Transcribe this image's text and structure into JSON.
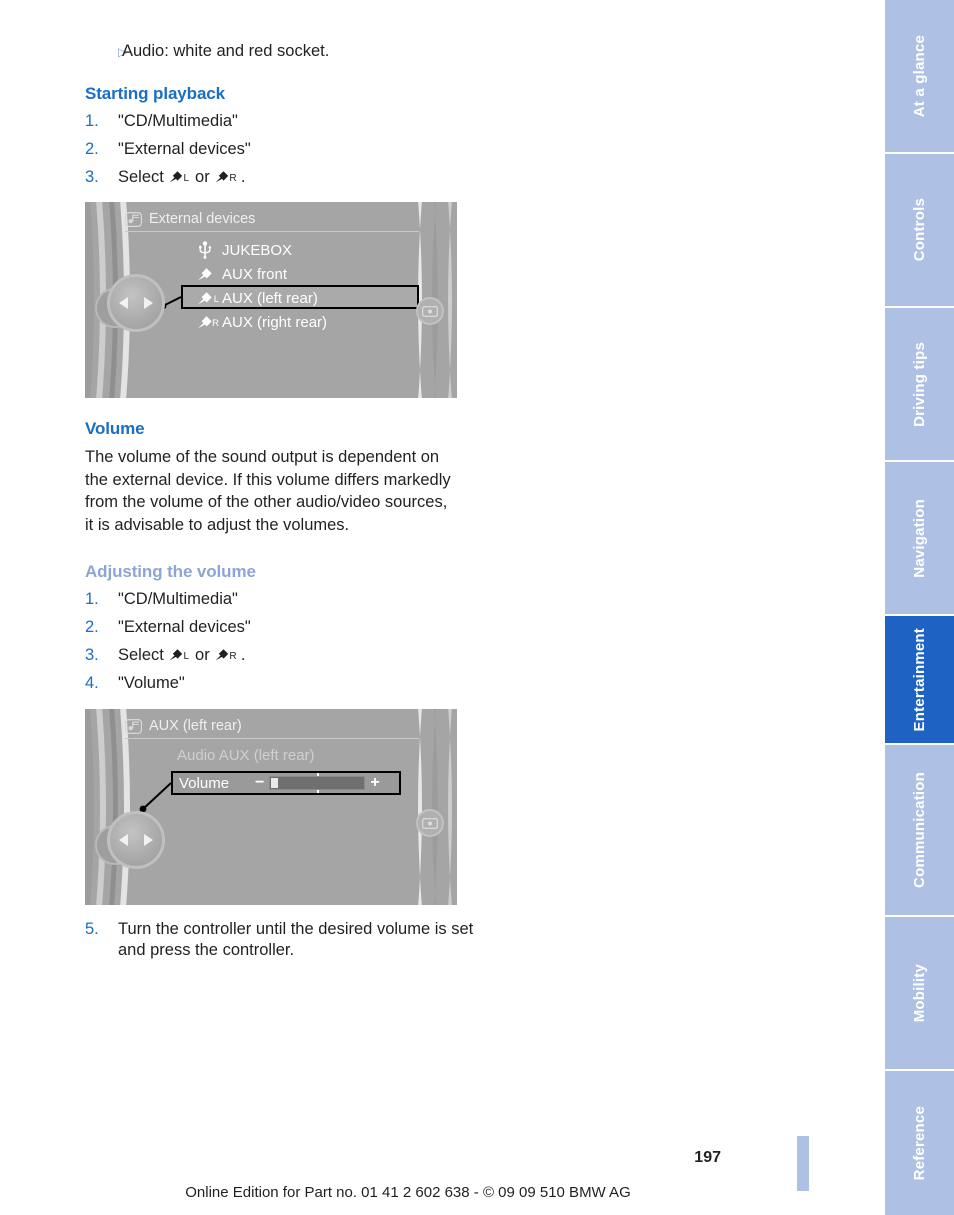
{
  "document": {
    "page_number": "197",
    "footer": "Online Edition for Part no. 01 41 2 602 638 - © 09 09 510 BMW AG"
  },
  "content": {
    "bullet": {
      "marker": "▷",
      "text": "Audio: white and red socket."
    },
    "starting_playback": {
      "heading": "Starting playback",
      "steps": [
        {
          "num": "1.",
          "text": "\"CD/Multimedia\""
        },
        {
          "num": "2.",
          "text": "\"External devices\""
        },
        {
          "num": "3.",
          "prefix": "Select",
          "icon_left": "L",
          "middle": "or",
          "icon_right": "R",
          "suffix": "."
        }
      ]
    },
    "volume": {
      "heading": "Volume",
      "body": "The volume of the sound output is dependent on the external device. If this volume differs markedly from the volume of the other audio/video sources, it is advisable to adjust the volumes."
    },
    "adjusting_volume": {
      "heading": "Adjusting the volume",
      "steps": [
        {
          "num": "1.",
          "text": "\"CD/Multimedia\""
        },
        {
          "num": "2.",
          "text": "\"External devices\""
        },
        {
          "num": "3.",
          "prefix": "Select",
          "icon_left": "L",
          "middle": "or",
          "icon_right": "R",
          "suffix": "."
        },
        {
          "num": "4.",
          "text": "\"Volume\""
        }
      ],
      "final_step": {
        "num": "5.",
        "text": "Turn the controller until the desired volume is set and press the controller."
      }
    }
  },
  "screen_external_devices": {
    "header_icon": "cd-multimedia-icon",
    "header_title": "External devices",
    "items": [
      {
        "icon": "usb-icon",
        "sub": "",
        "label": "JUKEBOX",
        "selected": false
      },
      {
        "icon": "jack-plug-icon",
        "sub": "",
        "label": "AUX front",
        "selected": false
      },
      {
        "icon": "jack-plug-icon",
        "sub": "L",
        "label": "AUX (left rear)",
        "selected": true
      },
      {
        "icon": "jack-plug-icon",
        "sub": "R",
        "label": "AUX (right rear)",
        "selected": false
      }
    ],
    "controller_icon": "idrive-controller",
    "side_button_icon": "display-icon"
  },
  "screen_aux_volume": {
    "header_icon": "cd-multimedia-icon",
    "header_title": "AUX (left rear)",
    "source_label": "Audio AUX (left rear)",
    "volume_label": "Volume",
    "minus": "−",
    "plus": "+",
    "volume_value_percent": 6,
    "controller_icon": "idrive-controller",
    "side_button_icon": "display-icon"
  },
  "tabs": [
    {
      "label": "At a glance",
      "active": false
    },
    {
      "label": "Controls",
      "active": false
    },
    {
      "label": "Driving tips",
      "active": false
    },
    {
      "label": "Navigation",
      "active": false
    },
    {
      "label": "Entertainment",
      "active": true
    },
    {
      "label": "Communication",
      "active": false
    },
    {
      "label": "Mobility",
      "active": false
    },
    {
      "label": "Reference",
      "active": false
    }
  ],
  "colors": {
    "heading_blue": "#1a6ec4",
    "heading_light_blue": "#8da5d6",
    "tab_inactive": "#aec0e4",
    "tab_active": "#1e63c4",
    "screen_bg": "#a5a5a5"
  }
}
